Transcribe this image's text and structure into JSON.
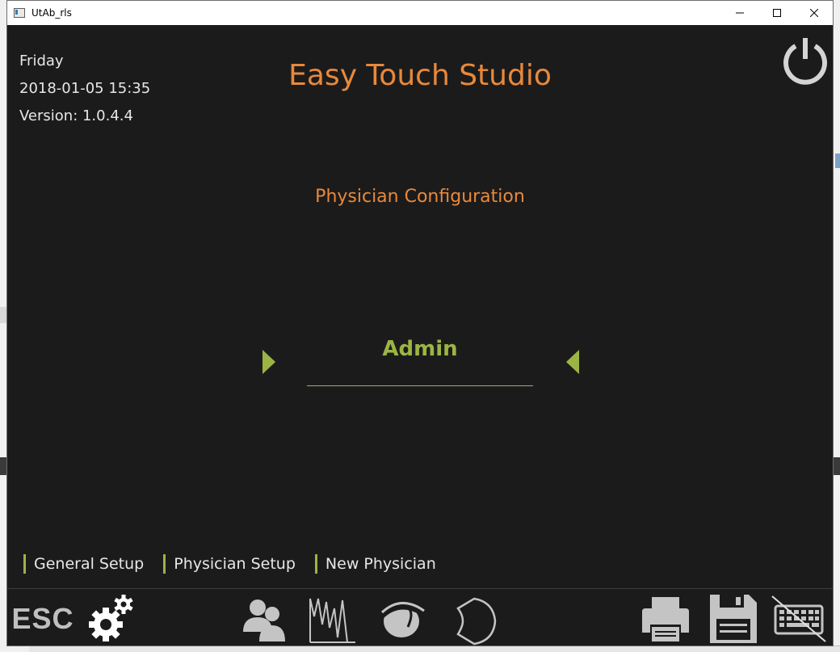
{
  "window": {
    "title": "UtAb_rls"
  },
  "info": {
    "day": "Friday",
    "datetime": "2018-01-05 15:35",
    "version": "Version: 1.0.4.4"
  },
  "app": {
    "brand": "Easy Touch Studio"
  },
  "page": {
    "title": "Physician Configuration"
  },
  "selector": {
    "value": "Admin"
  },
  "tabs": [
    {
      "label": "General Setup"
    },
    {
      "label": "Physician Setup"
    },
    {
      "label": "New Physician"
    }
  ],
  "toolbar": {
    "esc_label": "ESC",
    "icons": [
      "settings-icon",
      "users-icon",
      "waveform-icon",
      "eye-icon",
      "probe-icon",
      "printer-icon",
      "save-icon",
      "keyboard-disabled-icon"
    ]
  },
  "colors": {
    "background": "#1c1b1c",
    "brand_orange": "#e8893a",
    "accent_green": "#9bb544",
    "icon_gray": "#c4c4c4",
    "text_light": "#e7e7e7"
  }
}
